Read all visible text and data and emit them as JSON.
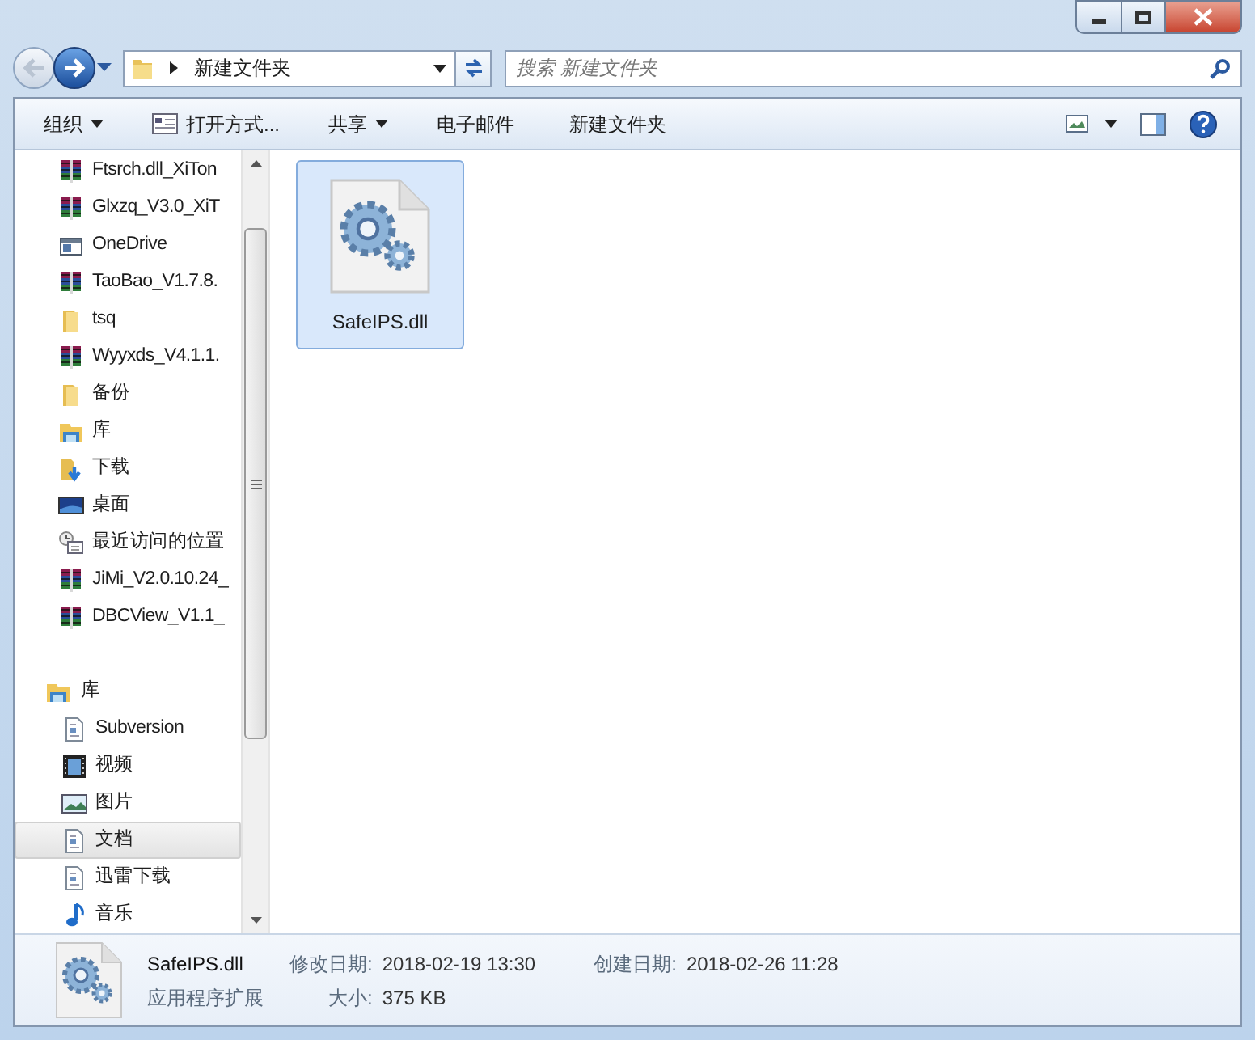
{
  "address": {
    "path": "新建文件夹"
  },
  "search": {
    "placeholder": "搜索 新建文件夹"
  },
  "toolbar": [
    {
      "label": "组织",
      "kind": "menu"
    },
    {
      "label": "打开方式...",
      "kind": "open"
    },
    {
      "label": "共享",
      "kind": "menu"
    },
    {
      "label": "电子邮件",
      "kind": "plain"
    },
    {
      "label": "新建文件夹",
      "kind": "plain"
    }
  ],
  "sidebar": {
    "items": [
      {
        "label": "Ftsrch.dll_XiTon",
        "kind": "archive",
        "selected": false
      },
      {
        "label": "Glxzq_V3.0_XiT",
        "kind": "archive",
        "selected": false
      },
      {
        "label": "OneDrive",
        "kind": "app",
        "selected": false
      },
      {
        "label": "TaoBao_V1.7.8.",
        "kind": "archive",
        "selected": false
      },
      {
        "label": "tsq",
        "kind": "folder",
        "selected": false
      },
      {
        "label": "Wyyxds_V4.1.1.",
        "kind": "archive",
        "selected": false
      },
      {
        "label": "备份",
        "kind": "folder",
        "selected": false
      },
      {
        "label": "库",
        "kind": "library",
        "selected": false
      },
      {
        "label": "下载",
        "kind": "download",
        "selected": false
      },
      {
        "label": "桌面",
        "kind": "desktop",
        "selected": false
      },
      {
        "label": "最近访问的位置",
        "kind": "recent",
        "selected": false
      },
      {
        "label": "JiMi_V2.0.10.24_",
        "kind": "archive",
        "selected": false
      },
      {
        "label": "DBCView_V1.1_",
        "kind": "archive",
        "selected": false
      }
    ],
    "groups": [
      {
        "label": "库",
        "kind": "library",
        "children": [
          {
            "label": "Subversion",
            "kind": "doc",
            "selected": false
          },
          {
            "label": "视频",
            "kind": "video",
            "selected": false
          },
          {
            "label": "图片",
            "kind": "image",
            "selected": false
          },
          {
            "label": "文档",
            "kind": "doc",
            "selected": true
          },
          {
            "label": "迅雷下载",
            "kind": "doc",
            "selected": false
          },
          {
            "label": "音乐",
            "kind": "music",
            "selected": false
          }
        ]
      }
    ]
  },
  "files": [
    {
      "name": "SafeIPS.dll",
      "selected": true
    }
  ],
  "details": {
    "name": "SafeIPS.dll",
    "type": "应用程序扩展",
    "fields": [
      {
        "label": "修改日期:",
        "value": "2018-02-19 13:30"
      },
      {
        "label": "大小:",
        "value": "375 KB"
      },
      {
        "label": "创建日期:",
        "value": "2018-02-26 11:28"
      }
    ]
  }
}
